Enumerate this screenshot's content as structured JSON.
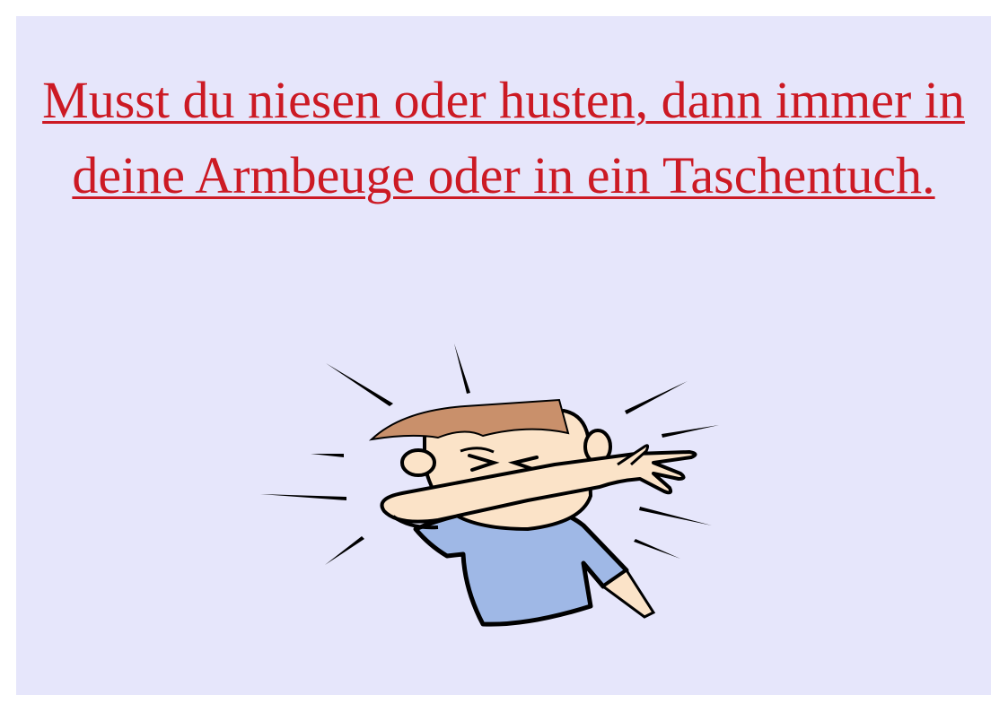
{
  "notice": {
    "text": "Musst du niesen oder husten, dann immer in deine Armbeuge oder in ein Taschentuch.",
    "color": "#cc1a24",
    "background": "#e6e6fb"
  },
  "illustration": {
    "subject": "sneezing-child-icon",
    "colors": {
      "shirt": "#9fb8e6",
      "skin": "#fbe3c8",
      "hair": "#c9906b"
    }
  }
}
